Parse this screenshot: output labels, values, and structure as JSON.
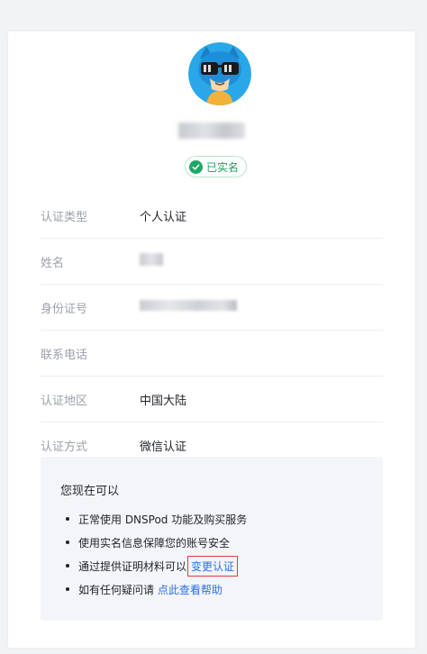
{
  "profile": {
    "verified_badge": "已实名"
  },
  "info_rows": [
    {
      "label": "认证类型",
      "value": "个人认证"
    },
    {
      "label": "姓名",
      "value": ""
    },
    {
      "label": "身份证号",
      "value": ""
    },
    {
      "label": "联系电话",
      "value": ""
    },
    {
      "label": "认证地区",
      "value": "中国大陆"
    },
    {
      "label": "认证方式",
      "value": "微信认证"
    }
  ],
  "panel": {
    "title": "您现在可以",
    "items": [
      {
        "text": "正常使用 DNSPod 功能及购买服务"
      },
      {
        "text": "使用实名信息保障您的账号安全"
      },
      {
        "text": "通过提供证明材料可以",
        "link": "变更认证"
      },
      {
        "text": "如有任何疑问请 ",
        "link": "点此查看帮助"
      }
    ]
  },
  "colors": {
    "accent_link": "#2b6ef6",
    "verified_green": "#1ea867",
    "highlight_box": "#e23b3b",
    "avatar_bg": "#2aa7e8"
  },
  "icons": {
    "avatar": "cartoon-sunglasses-avatar",
    "badge": "check-circle-icon"
  }
}
